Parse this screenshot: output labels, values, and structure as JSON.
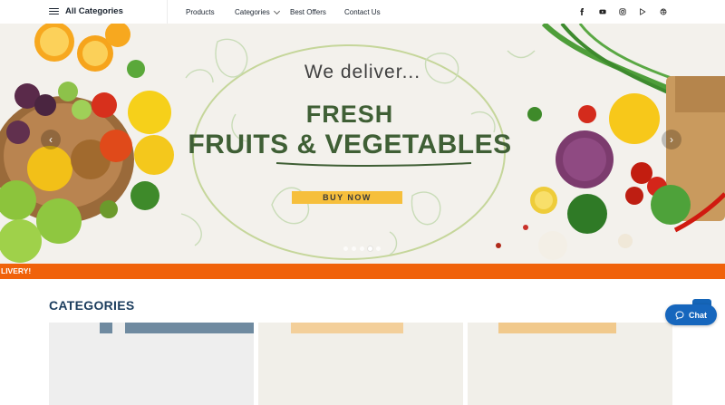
{
  "header": {
    "all_categories": "All Categories",
    "nav": [
      {
        "label": "Products"
      },
      {
        "label": "Categories"
      },
      {
        "label": "Best Offers"
      },
      {
        "label": "Contact Us"
      }
    ],
    "social": [
      "facebook-icon",
      "youtube-icon",
      "instagram-icon",
      "google-play-icon",
      "dribbble-icon"
    ]
  },
  "hero": {
    "tagline": "We deliver...",
    "headline_line1": "FRESH",
    "headline_line2": "FRUITS & VEGETABLES",
    "cta": "BUY NOW",
    "prev": "‹",
    "next": "›",
    "slide_count": 5,
    "active_slide": 4
  },
  "ticker": {
    "text": "LIVERY!"
  },
  "categories": {
    "title": "CATEGORIES"
  },
  "chat": {
    "label": "Chat"
  },
  "colors": {
    "brand_orange": "#f0620a",
    "brand_blue": "#1666bd",
    "headline_green": "#3f5f35",
    "cta_yellow": "#f6bf3c",
    "title_navy": "#1c3d5e"
  }
}
